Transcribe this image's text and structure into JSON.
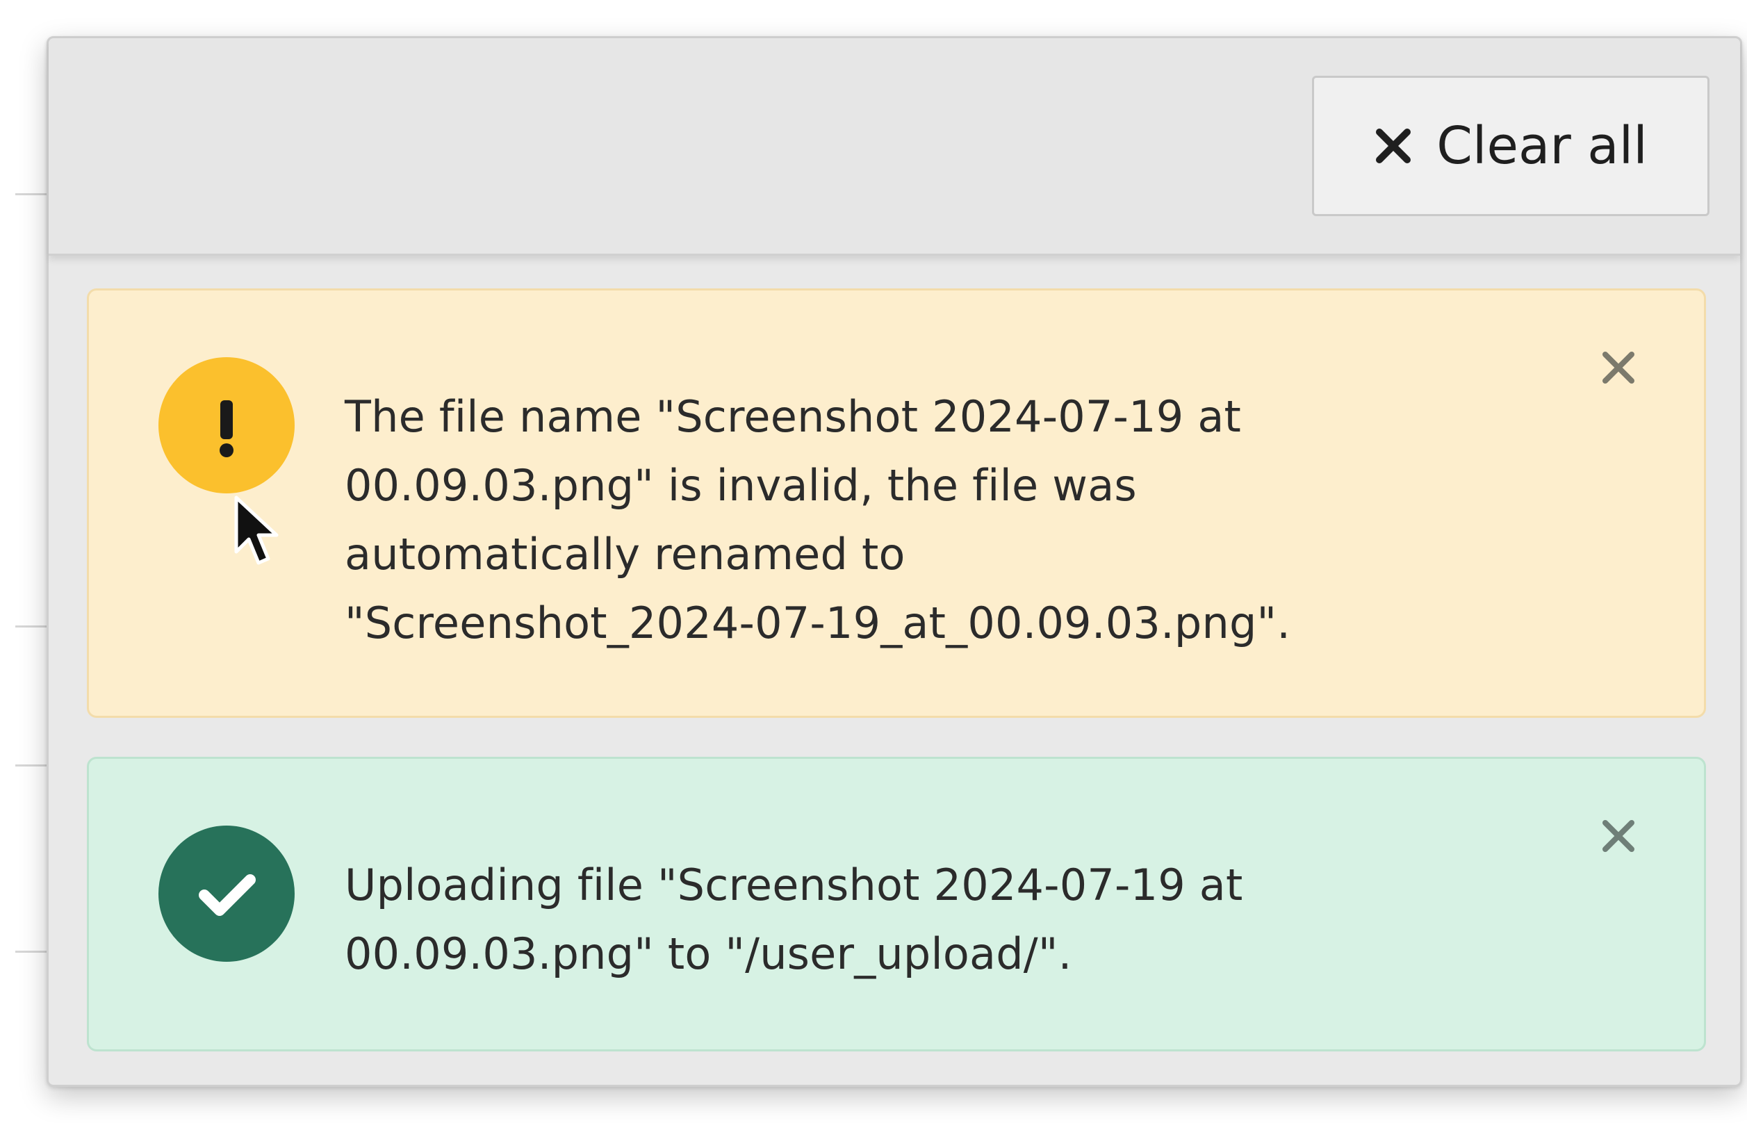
{
  "toolbar": {
    "clear_all_label": "Clear all"
  },
  "notifications": [
    {
      "type": "warning",
      "icon": "exclamation-icon",
      "color": "#fbc02d",
      "lines": [
        "The file name \"Screenshot 2024-07-19 at",
        "00.09.03.png\" is invalid, the file was",
        "automatically renamed to",
        "\"Screenshot_2024-07-19_at_00.09.03.png\"."
      ]
    },
    {
      "type": "success",
      "icon": "check-icon",
      "color": "#27725a",
      "lines": [
        "Uploading file \"Screenshot 2024-07-19 at",
        "00.09.03.png\" to \"/user_upload/\"."
      ]
    }
  ],
  "colors": {
    "warning_bg": "#fdeecd",
    "success_bg": "#d7f2e4",
    "panel_bg": "#e9e9e9"
  }
}
